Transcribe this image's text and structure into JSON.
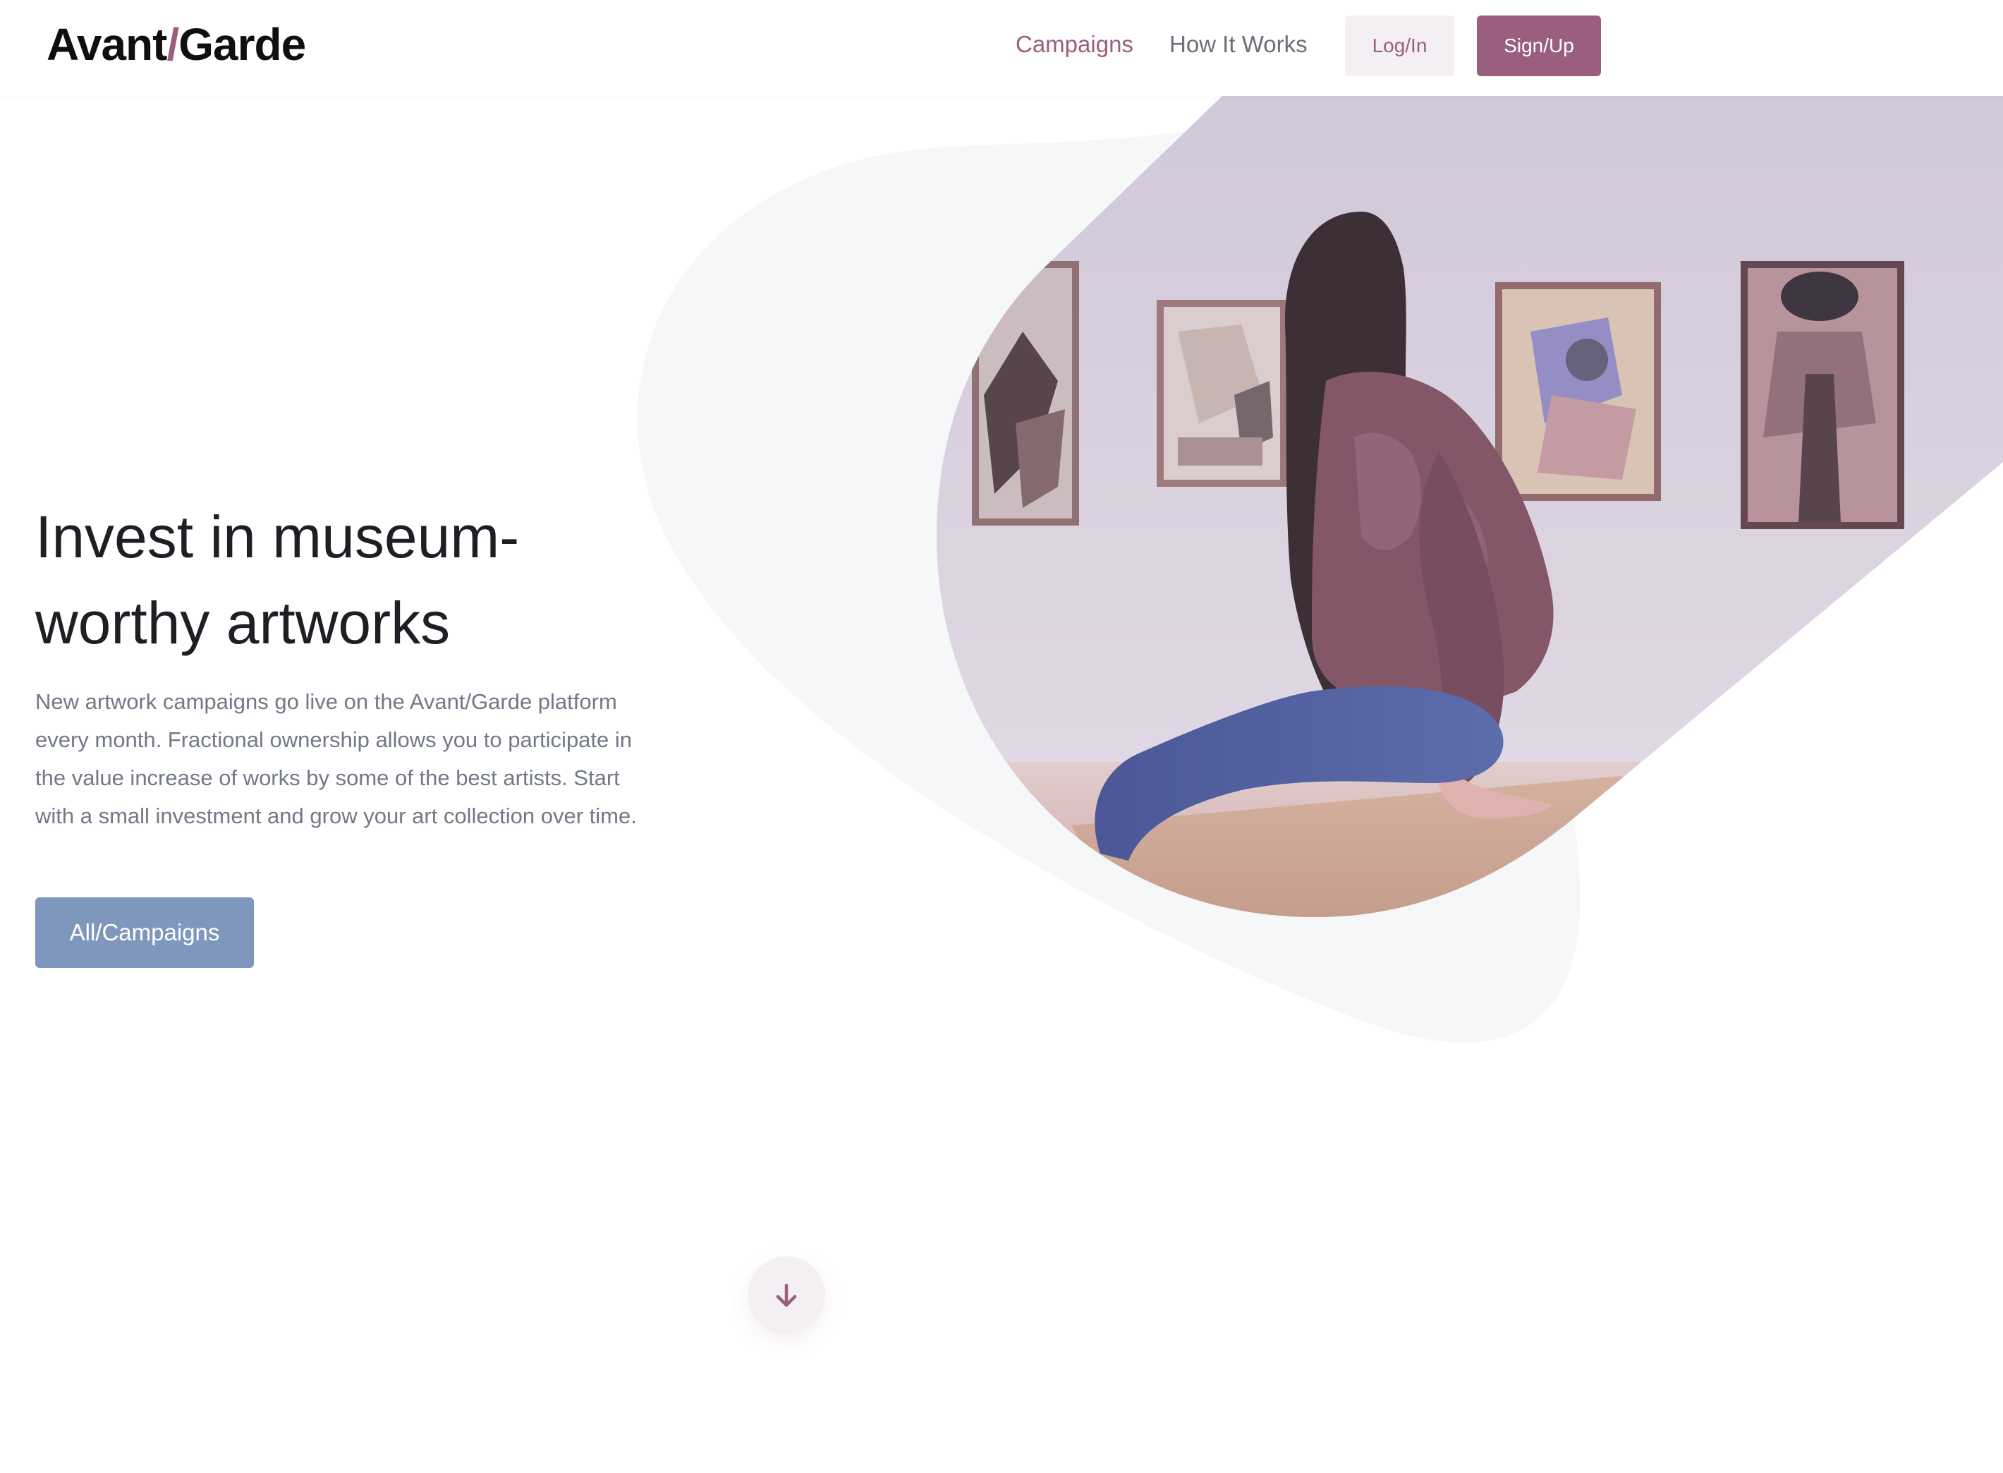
{
  "header": {
    "logo": {
      "left": "Avant",
      "slash": "/",
      "right": "Garde"
    },
    "nav": {
      "campaigns": "Campaigns",
      "how_it_works": "How It Works"
    },
    "login_label": "Log/In",
    "signup_label": "Sign/Up"
  },
  "hero": {
    "title_line1": "Invest in museum-",
    "title_line2": "worthy artworks",
    "description": "New artwork campaigns go live on the Avant/Garde platform every month. Fractional ownership allows you to participate in the value increase of works by some of the best artists. Start with a small investment and grow your art collection over time.",
    "cta_label": "All/Campaigns",
    "image_alt": "Woman sitting on a bench in an art gallery looking at paintings"
  },
  "icons": {
    "scroll": "arrow-down-icon"
  },
  "colors": {
    "brand": "#9a5e7f",
    "brand_light": "#f4eff3",
    "cta": "#7f97bd",
    "text_dark": "#1e1f24",
    "text_muted": "#727885",
    "blob": "#f6f7f8"
  }
}
